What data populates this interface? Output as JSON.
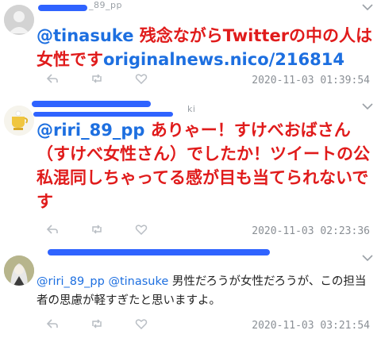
{
  "tweets": [
    {
      "user_hint": "_89_pp",
      "mention": "@tinasuke",
      "text": " 残念ながらTwitterの中の人は女性です",
      "link": "originalnews.nico/216814",
      "time": "2020-11-03 01:39:54"
    },
    {
      "user_hint": "ki",
      "mention": "@riri_89_pp",
      "text": " ありゃー！すけべおばさん（すけべ女性さん）でしたか！ツイートの公私混同しちゃってる感が目も当てられないです",
      "time": "2020-11-03 02:23:36"
    },
    {
      "mentions": "@riri_89_pp @tinasuke",
      "text": " 男性だろうが女性だろうが、この担当者の思慮が軽すぎたと思いますよ。",
      "time": "2020-11-03 03:21:54"
    }
  ],
  "icons": [
    "reply-icon",
    "retweet-icon",
    "like-icon",
    "chevron-down-icon"
  ],
  "colors": {
    "mention": "#1d6fe0",
    "emphasis_text": "#e01b1b",
    "redaction": "#2f63ff"
  }
}
